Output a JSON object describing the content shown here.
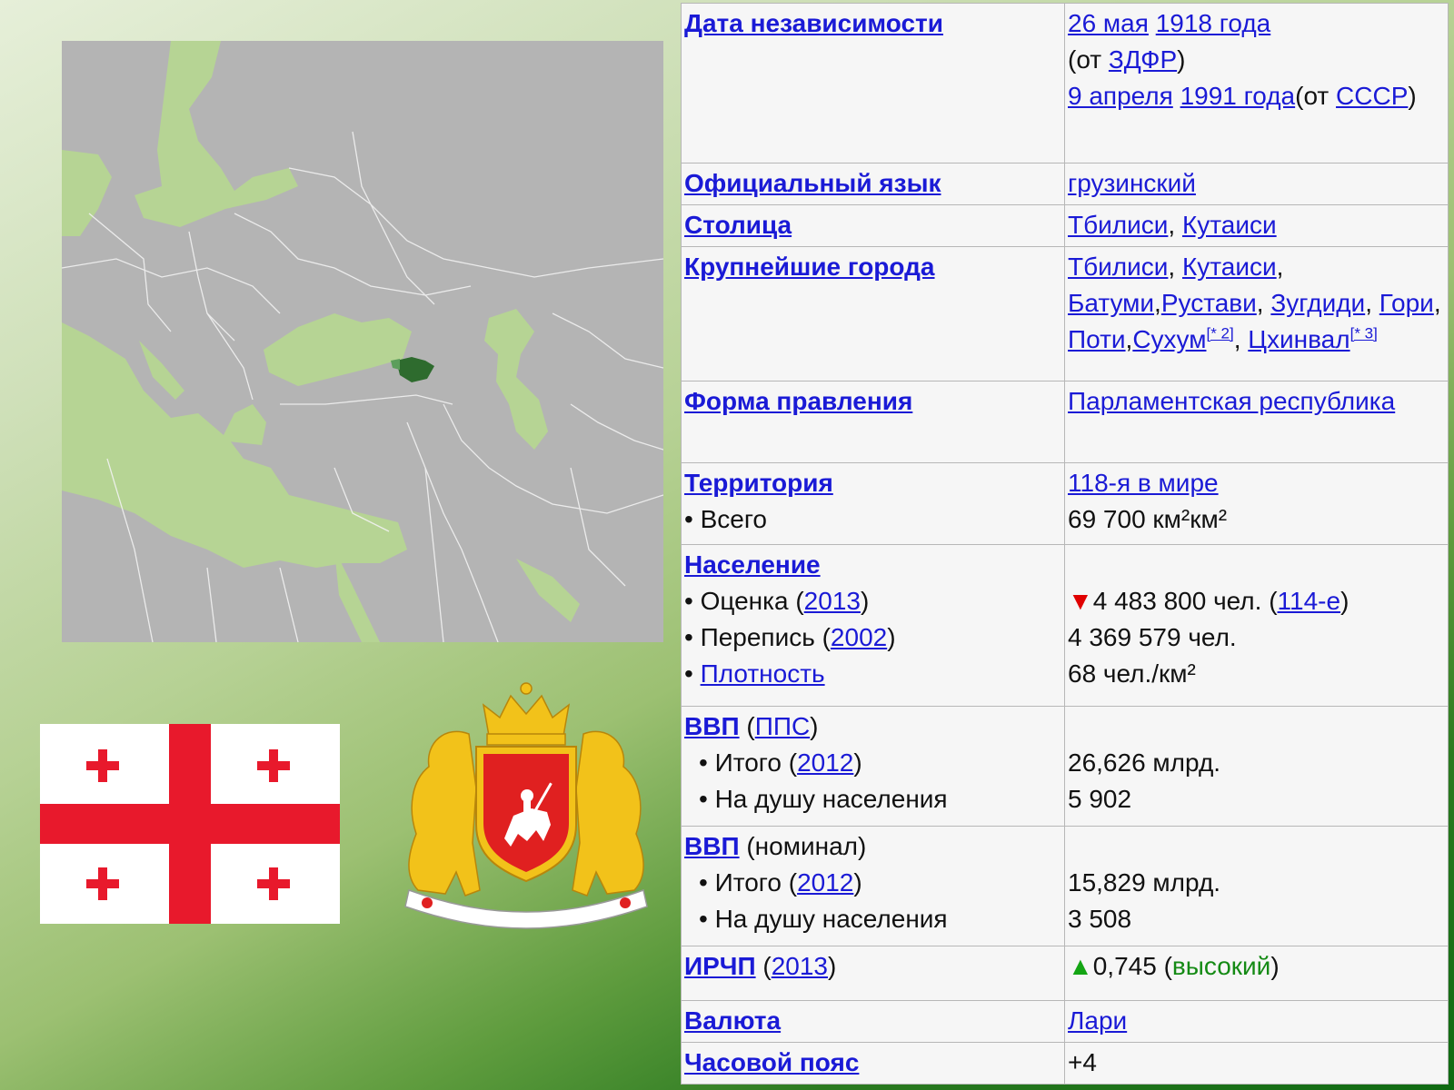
{
  "images": {
    "map": {
      "icon": "europe-map-georgia-highlighted",
      "colors": {
        "land": "#b4b4b4",
        "water": "#b6d494",
        "georgia": "#2e6b2e",
        "borders": "#f2f2f2"
      }
    },
    "flag": {
      "icon": "georgia-flag",
      "colors": {
        "field": "#ffffff",
        "cross": "#e8192c"
      }
    },
    "coat": {
      "icon": "georgia-coat-of-arms",
      "colors": {
        "gold": "#f2c21a",
        "shield": "#e02020"
      }
    }
  },
  "rows": {
    "independence": {
      "label": "Дата независимости",
      "d1": "26 мая",
      "y1": "1918 года",
      "from_open": "(от ",
      "zdfr": "ЗДФР",
      "from_close": ")",
      "d2": "9 апреля",
      "y2": "1991 года",
      "from2_open": "(от ",
      "ussr": "СССР",
      "from2_close": ")"
    },
    "language": {
      "label": "Официальный язык",
      "value": "грузинский"
    },
    "capital": {
      "label": "Столица",
      "c1": "Тбилиси",
      "c2": "Кутаиси"
    },
    "cities": {
      "label": "Крупнейшие города",
      "list": [
        "Тбилиси",
        "Кутаиси",
        "Батуми",
        "Рустави",
        "Зугдиди",
        "Гори",
        "Поти",
        "Сухум",
        "Цхинвал"
      ],
      "note1": "[* 2]",
      "note2": "[* 3]"
    },
    "government": {
      "label": "Форма правления",
      "value": "Парламентская республика"
    },
    "territory": {
      "label": "Территория",
      "rank": "118-я в мире",
      "total_label": "• Всего",
      "total": "69 700 км²км²"
    },
    "population": {
      "label": "Население",
      "estimate_label": "• Оценка (",
      "estimate_year": "2013",
      "estimate": "4 483 800 чел.",
      "estimate_rank": "114-е",
      "census_label": "• Перепись (",
      "census_year": "2002",
      "census": "4 369 579 чел.",
      "density_bullet": "• ",
      "density_label": "Плотность",
      "density": "68 чел./км²"
    },
    "gdp_ppp": {
      "label": "ВВП",
      "sub": "ППС",
      "total_label": "• Итого (",
      "year": "2012",
      "total": "26,626 млрд.",
      "per_capita_label": "• На душу населения",
      "per_capita": "5 902"
    },
    "gdp_nominal": {
      "label": "ВВП",
      "sub": "(номинал)",
      "total_label": "• Итого (",
      "year": "2012",
      "total": "15,829 млрд.",
      "per_capita_label": "• На душу населения",
      "per_capita": "3 508"
    },
    "hdi": {
      "label": "ИРЧП",
      "year": "2013",
      "value": "0,745",
      "level": "высокий"
    },
    "currency": {
      "label": "Валюта",
      "value": "Лари"
    },
    "timezone": {
      "label": "Часовой пояс",
      "value": "+4"
    }
  }
}
